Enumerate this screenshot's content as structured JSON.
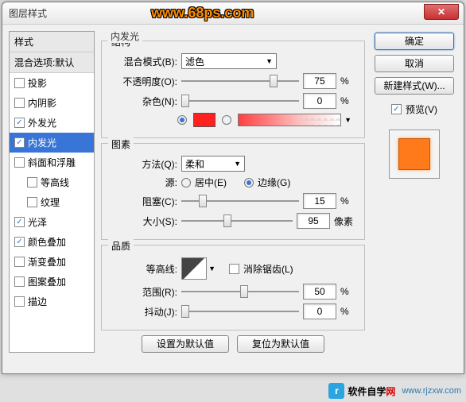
{
  "window_title": "图层样式",
  "overlay_url": "www.68ps.com",
  "footer_site": {
    "name_black": "软件自学",
    "name_red": "网",
    "url": "www.rjzxw.com"
  },
  "stylelist": {
    "header": "样式",
    "blend": "混合选项:默认",
    "items": [
      {
        "label": "投影",
        "checked": false,
        "selected": false
      },
      {
        "label": "内阴影",
        "checked": false,
        "selected": false
      },
      {
        "label": "外发光",
        "checked": true,
        "selected": false
      },
      {
        "label": "内发光",
        "checked": true,
        "selected": true
      },
      {
        "label": "斜面和浮雕",
        "checked": false,
        "selected": false
      },
      {
        "label": "等高线",
        "checked": false,
        "selected": false,
        "indent": true
      },
      {
        "label": "纹理",
        "checked": false,
        "selected": false,
        "indent": true
      },
      {
        "label": "光泽",
        "checked": true,
        "selected": false
      },
      {
        "label": "颜色叠加",
        "checked": true,
        "selected": false
      },
      {
        "label": "渐变叠加",
        "checked": false,
        "selected": false
      },
      {
        "label": "图案叠加",
        "checked": false,
        "selected": false
      },
      {
        "label": "描边",
        "checked": false,
        "selected": false
      }
    ]
  },
  "main_title": "内发光",
  "structure": {
    "legend": "结构",
    "blend_mode_label": "混合模式(B):",
    "blend_mode_value": "滤色",
    "opacity_label": "不透明度(O):",
    "opacity_value": "75",
    "opacity_unit": "%",
    "noise_label": "杂色(N):",
    "noise_value": "0",
    "noise_unit": "%",
    "color_swatch": "#ff2020"
  },
  "elements": {
    "legend": "图素",
    "method_label": "方法(Q):",
    "method_value": "柔和",
    "source_label": "源:",
    "source_center": "居中(E)",
    "source_edge": "边缘(G)",
    "choke_label": "阻塞(C):",
    "choke_value": "15",
    "choke_unit": "%",
    "size_label": "大小(S):",
    "size_value": "95",
    "size_unit": "像素"
  },
  "quality": {
    "legend": "品质",
    "contour_label": "等高线:",
    "antialias_label": "消除锯齿(L)",
    "range_label": "范围(R):",
    "range_value": "50",
    "range_unit": "%",
    "jitter_label": "抖动(J):",
    "jitter_value": "0",
    "jitter_unit": "%"
  },
  "footer_buttons": {
    "default": "设置为默认值",
    "reset": "复位为默认值"
  },
  "right": {
    "ok": "确定",
    "cancel": "取消",
    "newstyle": "新建样式(W)...",
    "preview_label": "预览(V)"
  }
}
